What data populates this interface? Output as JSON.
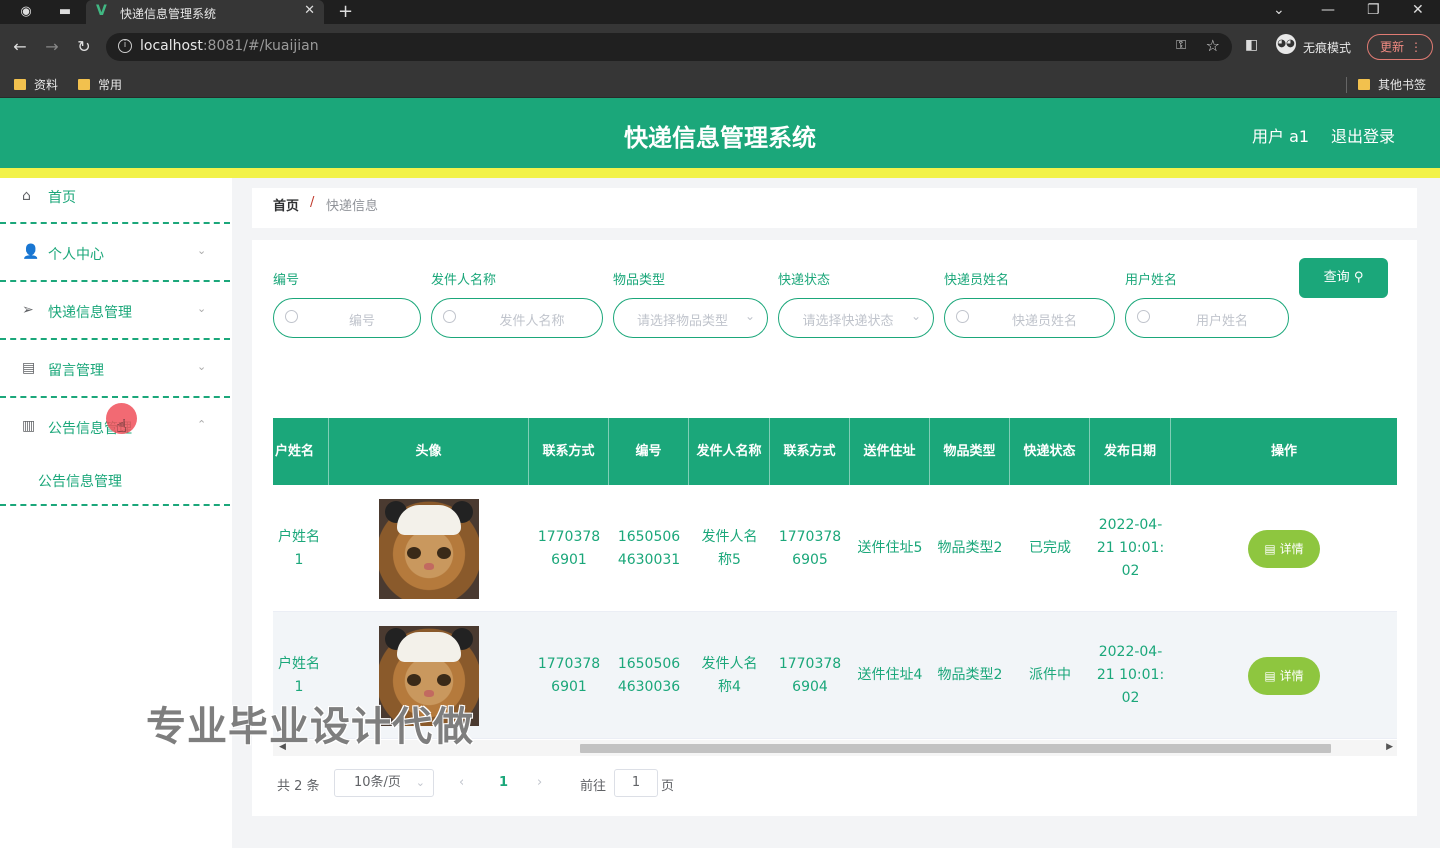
{
  "browser": {
    "tab_title": "快递信息管理系统",
    "url_host": "localhost",
    "url_rest": ":8081/#/kuaijian",
    "incognito_label": "无痕模式",
    "update_label": "更新",
    "bookmarks": [
      "资料",
      "常用"
    ],
    "other_bookmarks": "其他书签"
  },
  "header": {
    "title": "快递信息管理系统",
    "user": "用户 a1",
    "logout": "退出登录"
  },
  "sidebar": {
    "items": [
      {
        "label": "首页"
      },
      {
        "label": "个人中心"
      },
      {
        "label": "快递信息管理"
      },
      {
        "label": "留言管理"
      },
      {
        "label": "公告信息管理"
      }
    ],
    "submenu": "公告信息管理"
  },
  "breadcrumb": {
    "home": "首页",
    "separator": "/",
    "current": "快递信息"
  },
  "filters": {
    "fields": [
      {
        "label": "编号",
        "placeholder": "编号"
      },
      {
        "label": "发件人名称",
        "placeholder": "发件人名称"
      },
      {
        "label": "物品类型",
        "placeholder": "请选择物品类型"
      },
      {
        "label": "快递状态",
        "placeholder": "请选择快递状态"
      },
      {
        "label": "快递员姓名",
        "placeholder": "快递员姓名"
      },
      {
        "label": "用户姓名",
        "placeholder": "用户姓名"
      }
    ],
    "query_label": "查询"
  },
  "table": {
    "headers": [
      "户姓名",
      "头像",
      "联系方式",
      "编号",
      "发件人名称",
      "联系方式",
      "送件住址",
      "物品类型",
      "快递状态",
      "发布日期",
      "操作"
    ],
    "rows": [
      {
        "user_name": "户姓名1",
        "phone": "17703786901",
        "code": "16505064630031",
        "sender": "发件人名称5",
        "sender_phone": "17703786905",
        "address": "送件住址5",
        "item_type": "物品类型2",
        "status": "已完成",
        "date": "2022-04-21 10:01:02",
        "action": "详情"
      },
      {
        "user_name": "户姓名1",
        "phone": "17703786901",
        "code": "16505064630036",
        "sender": "发件人名称4",
        "sender_phone": "17703786904",
        "address": "送件住址4",
        "item_type": "物品类型2",
        "status": "派件中",
        "date": "2022-04-21 10:01:02",
        "action": "详情"
      }
    ]
  },
  "pagination": {
    "total": "共 2 条",
    "page_size": "10条/页",
    "current_page": "1",
    "goto_label": "前往",
    "goto_value": "1",
    "goto_unit": "页"
  },
  "watermark": "专业毕业设计代做",
  "colors": {
    "brand": "#1ba77a",
    "accent_bar": "#f2f249",
    "detail_button": "#8ec63f"
  }
}
